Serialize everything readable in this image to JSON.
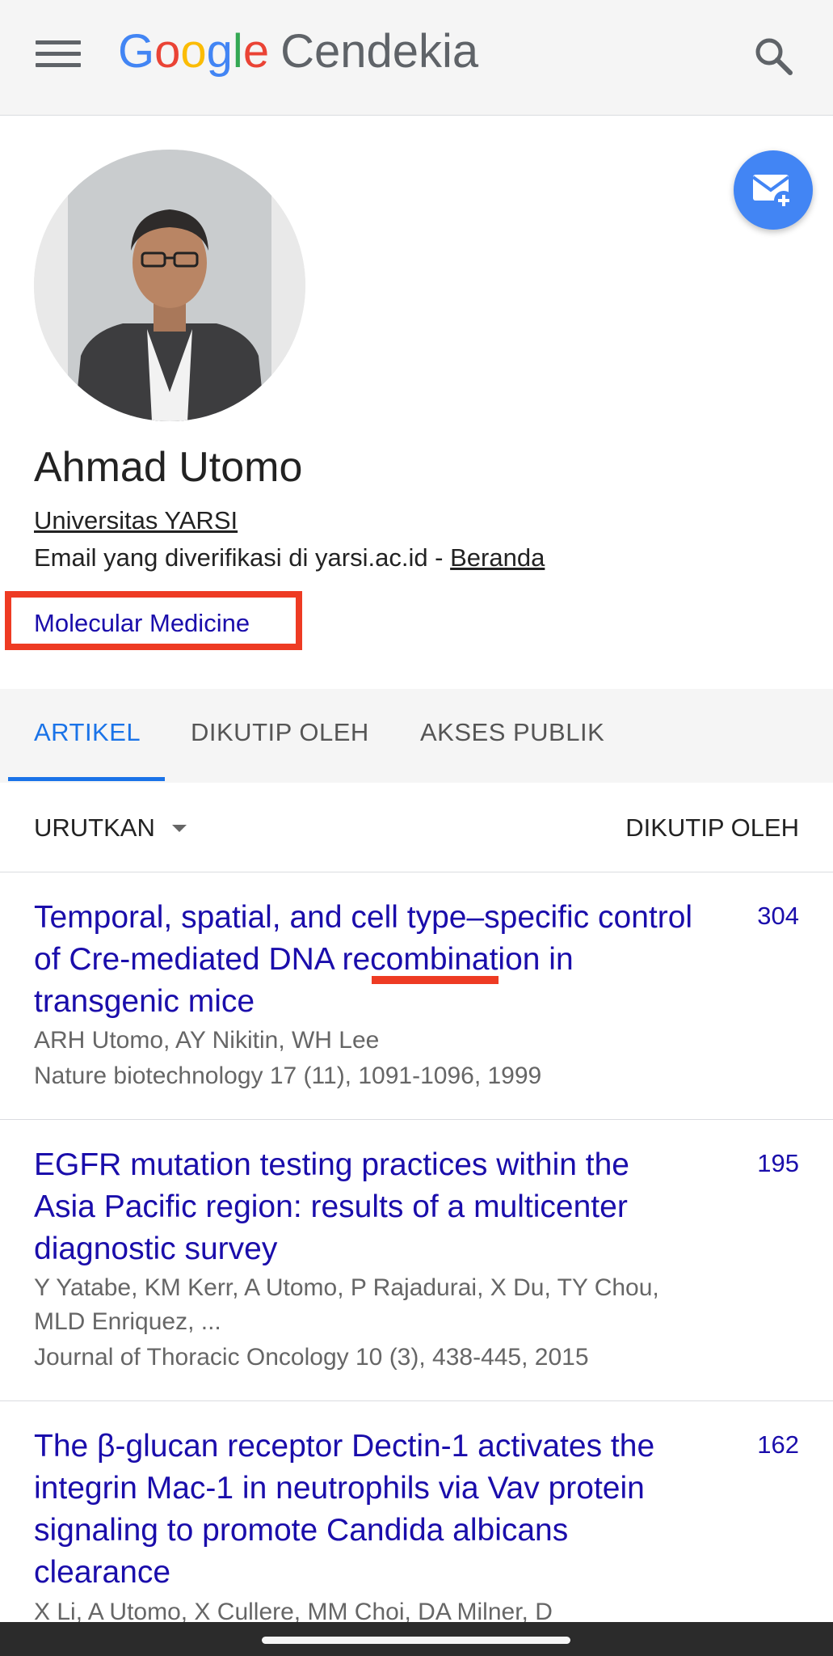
{
  "app": {
    "logo_letters": [
      "G",
      "o",
      "o",
      "g",
      "l",
      "e"
    ],
    "logo_colors": [
      "#4285f4",
      "#ea4335",
      "#fbbc05",
      "#4285f4",
      "#34a853",
      "#ea4335"
    ],
    "logo_suffix": "Cendekia"
  },
  "profile": {
    "name": "Ahmad Utomo",
    "affiliation": "Universitas YARSI",
    "email_text": "Email yang diverifikasi di yarsi.ac.id - ",
    "homepage_link": "Beranda",
    "interest": "Molecular Medicine"
  },
  "tabs": [
    {
      "label": "ARTIKEL",
      "active": true
    },
    {
      "label": "DIKUTIP OLEH",
      "active": false
    },
    {
      "label": "AKSES PUBLIK",
      "active": false
    }
  ],
  "sort": {
    "label": "URUTKAN",
    "right_label": "DIKUTIP OLEH"
  },
  "articles": [
    {
      "title": "Temporal, spatial, and cell type–specific control of Cre-mediated DNA recombination in transgenic mice",
      "authors": "ARH Utomo, AY Nikitin, WH Lee",
      "venue": "Nature biotechnology 17 (11), 1091-1096, 1999",
      "cited_by": "304"
    },
    {
      "title": "EGFR mutation testing practices within the Asia Pacific region: results of a multicenter diagnostic survey",
      "authors": "Y Yatabe, KM Kerr, A Utomo, P Rajadurai, X Du, TY Chou, MLD Enriquez, ...",
      "venue": "Journal of Thoracic Oncology 10 (3), 438-445, 2015",
      "cited_by": "195"
    },
    {
      "title": "The β-glucan receptor Dectin-1 activates the integrin Mac-1 in neutrophils via Vav protein signaling to promote Candida albicans clearance",
      "authors": "X Li, A Utomo, X Cullere, MM Choi, DA Milner, D",
      "venue": "",
      "cited_by": "162"
    }
  ],
  "icons": {
    "menu": "menu-icon",
    "search": "search-icon",
    "follow": "mail-add-icon",
    "sort": "caret-down-icon"
  },
  "colors": {
    "link": "#1a0dab",
    "accent": "#1a73e8",
    "annotation": "#ee3b23",
    "fab": "#4285f4"
  }
}
